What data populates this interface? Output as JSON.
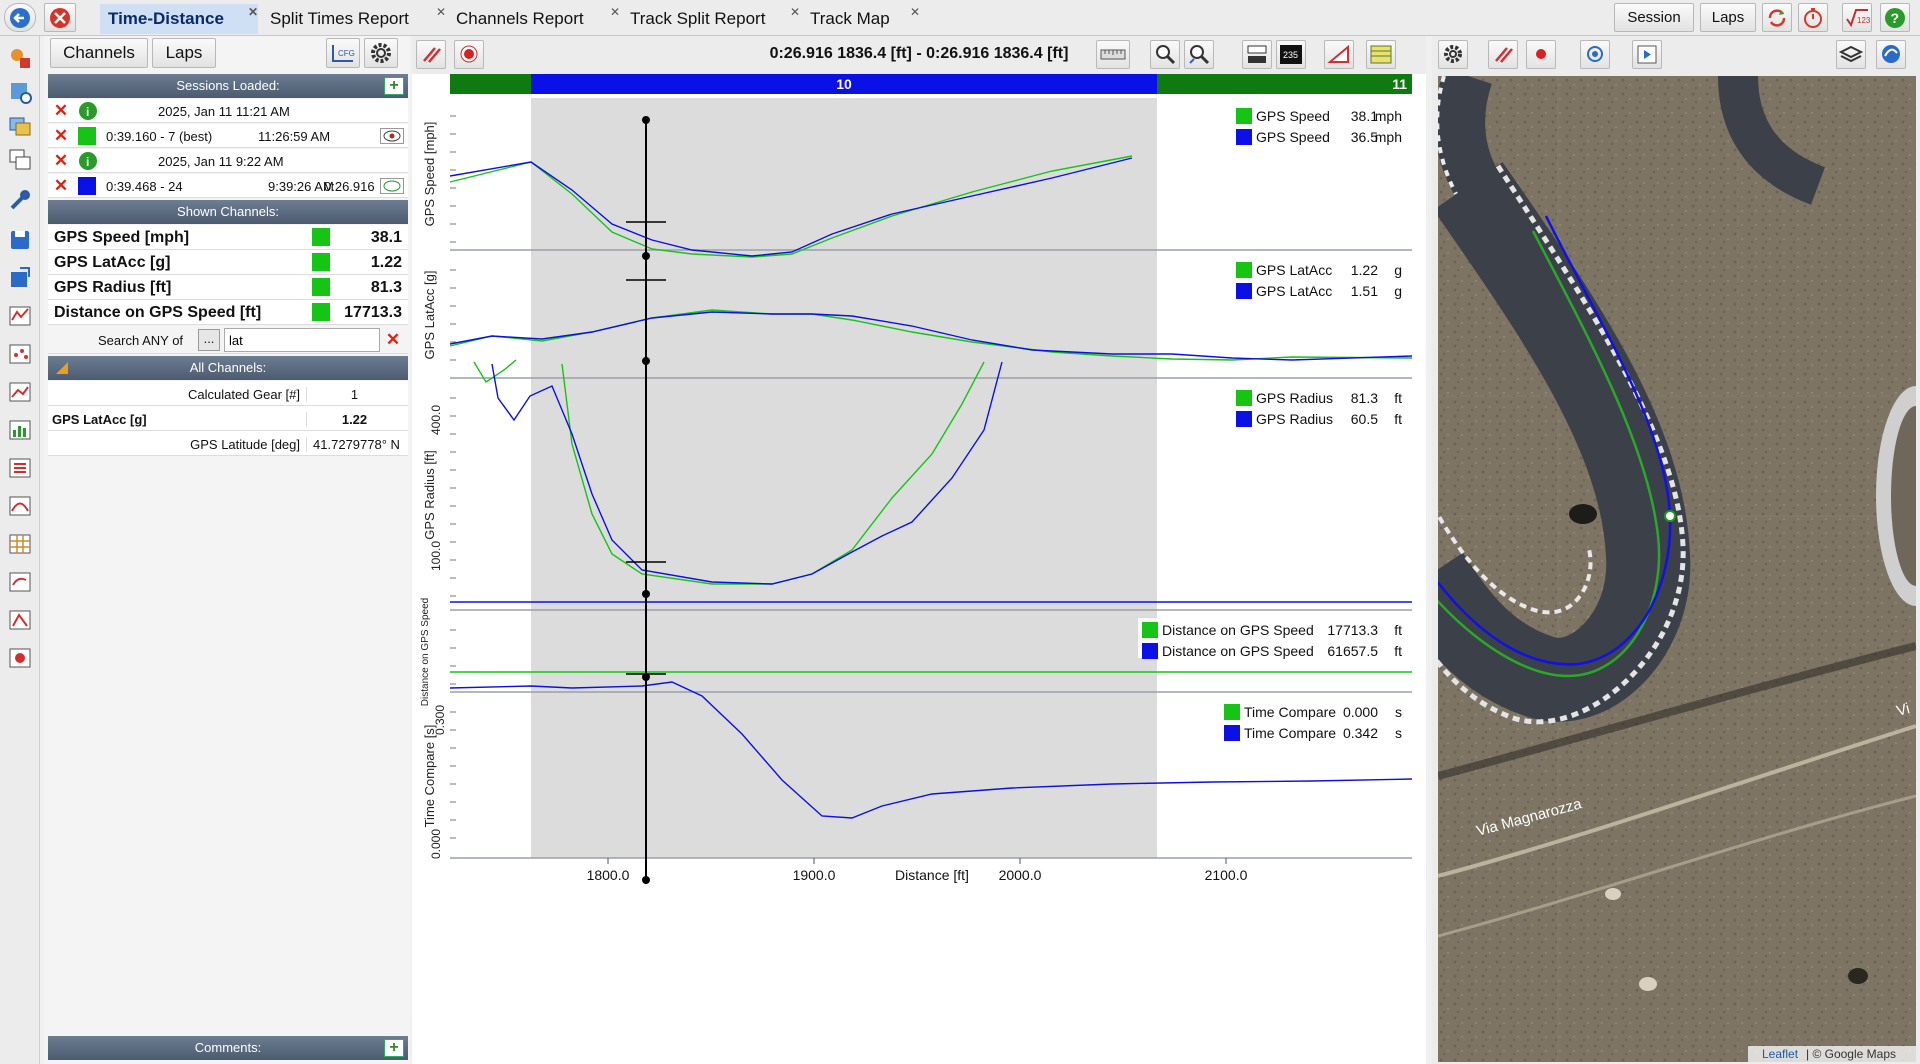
{
  "tabs": [
    {
      "label": "Time-Distance",
      "active": true
    },
    {
      "label": "Split Times Report",
      "active": false
    },
    {
      "label": "Channels Report",
      "active": false
    },
    {
      "label": "Track Split Report",
      "active": false
    },
    {
      "label": "Track Map",
      "active": false
    }
  ],
  "top_buttons": {
    "session": "Session",
    "laps": "Laps"
  },
  "left_panel": {
    "channels_btn": "Channels",
    "laps_btn": "Laps",
    "sessions_header": "Sessions Loaded:",
    "sessions": [
      {
        "date": "2025, Jan 11 11:21 AM",
        "lap": "0:39.160 - 7 (best)",
        "time": "11:26:59 AM",
        "extra": "",
        "color": "#16c416"
      },
      {
        "date": "2025, Jan 11 9:22 AM",
        "lap": "0:39.468 - 24",
        "time": "9:39:26 AM",
        "extra": "0:26.916",
        "color": "#0b10e6"
      }
    ],
    "shown_header": "Shown Channels:",
    "shown_channels": [
      {
        "name": "GPS Speed [mph]",
        "value": "38.1"
      },
      {
        "name": "GPS LatAcc [g]",
        "value": "1.22"
      },
      {
        "name": "GPS Radius [ft]",
        "value": "81.3"
      },
      {
        "name": "Distance on GPS Speed [ft]",
        "value": "17713.3"
      }
    ],
    "search_label": "Search ANY of",
    "search_dots": "...",
    "search_value": "lat",
    "all_header": "All Channels:",
    "all_channels": [
      {
        "name": "Calculated Gear [#]",
        "value": "1",
        "bold": false
      },
      {
        "name": "GPS LatAcc [g]",
        "value": "1.22",
        "bold": true
      },
      {
        "name": "GPS Latitude [deg]",
        "value": "41.7279778° N",
        "bold": false
      }
    ],
    "comments_header": "Comments:"
  },
  "graph": {
    "cursor_readout": "0:26.916   1836.4 [ft] - 0:26.916   1836.4 [ft]",
    "segment_label": "10",
    "segment_label_next": "11",
    "panels": [
      {
        "ylabel": "GPS Speed [mph]",
        "ticks": [],
        "legend": [
          {
            "name": "GPS Speed",
            "value": "38.1",
            "unit": "mph",
            "color": "#16c416"
          },
          {
            "name": "GPS Speed",
            "value": "36.5",
            "unit": "mph",
            "color": "#0b10e6"
          }
        ]
      },
      {
        "ylabel": "GPS LatAcc [g]",
        "ticks": [],
        "legend": [
          {
            "name": "GPS LatAcc",
            "value": "1.22",
            "unit": "g",
            "color": "#16c416"
          },
          {
            "name": "GPS LatAcc",
            "value": "1.51",
            "unit": "g",
            "color": "#0b10e6"
          }
        ]
      },
      {
        "ylabel": "GPS Radius [ft]",
        "ticks": [
          "400.0",
          "100.0"
        ],
        "legend": [
          {
            "name": "GPS Radius",
            "value": "81.3",
            "unit": "ft",
            "color": "#16c416"
          },
          {
            "name": "GPS Radius",
            "value": "60.5",
            "unit": "ft",
            "color": "#0b10e6"
          }
        ]
      },
      {
        "ylabel": "Distance on GPS Speed",
        "ticks": [],
        "legend": [
          {
            "name": "Distance on GPS Speed",
            "value": "17713.3",
            "unit": "ft",
            "color": "#16c416"
          },
          {
            "name": "Distance on GPS Speed",
            "value": "61657.5",
            "unit": "ft",
            "color": "#0b10e6"
          }
        ]
      },
      {
        "ylabel": "Time Compare [s]",
        "ticks": [
          "0.300",
          "0.000"
        ],
        "legend": [
          {
            "name": "Time Compare",
            "value": "0.000",
            "unit": "s",
            "color": "#16c416"
          },
          {
            "name": "Time Compare",
            "value": "0.342",
            "unit": "s",
            "color": "#0b10e6"
          }
        ]
      }
    ],
    "x_ticks": [
      "1800.0",
      "1900.0",
      "2000.0",
      "2100.0"
    ],
    "x_label": "Distance [ft]",
    "colors": {
      "green": "#16c416",
      "blue": "#0b10e6",
      "segment_green": "#0f7a10",
      "segment_blue": "#0b10e6"
    }
  },
  "map": {
    "road_label": "Via Magnarozza",
    "road_label_right": "Vi",
    "attribution_leaflet": "Leaflet",
    "attribution_google": "| © Google Maps"
  }
}
